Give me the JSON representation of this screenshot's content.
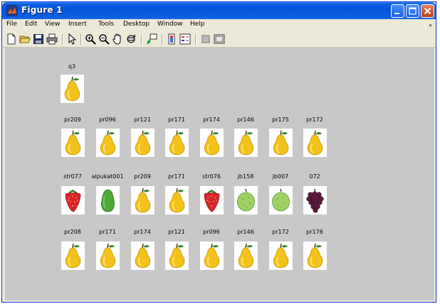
{
  "window": {
    "title": "Figure 1"
  },
  "menu": [
    "File",
    "Edit",
    "View",
    "Insert",
    "Tools",
    "Desktop",
    "Window",
    "Help"
  ],
  "menu_overflow": "»",
  "toolbar": {
    "buttons": [
      "new-figure-icon",
      "open-file-icon",
      "save-icon",
      "print-icon",
      "select-arrow-icon",
      "zoom-in-icon",
      "zoom-out-icon",
      "pan-hand-icon",
      "rotate-3d-icon",
      "data-cursor-icon",
      "insert-colorbar-icon",
      "insert-legend-icon",
      "hide-plot-tools-icon",
      "show-plot-tools-icon"
    ]
  },
  "figure": {
    "query": {
      "label": "q3",
      "fruit": "pear"
    },
    "rows": [
      [
        {
          "label": "pr209",
          "fruit": "pear"
        },
        {
          "label": "pr096",
          "fruit": "pear"
        },
        {
          "label": "pr121",
          "fruit": "pear"
        },
        {
          "label": "pr171",
          "fruit": "pear"
        },
        {
          "label": "pr174",
          "fruit": "pear"
        },
        {
          "label": "pr146",
          "fruit": "pear"
        },
        {
          "label": "pr175",
          "fruit": "pear"
        },
        {
          "label": "pr172",
          "fruit": "pear"
        }
      ],
      [
        {
          "label": "str077",
          "fruit": "strawberry"
        },
        {
          "label": "alpukat001",
          "fruit": "avocado"
        },
        {
          "label": "pr209",
          "fruit": "pear"
        },
        {
          "label": "pr171",
          "fruit": "pear"
        },
        {
          "label": "str076",
          "fruit": "strawberry"
        },
        {
          "label": "jb158",
          "fruit": "guava"
        },
        {
          "label": "jb007",
          "fruit": "guava"
        },
        {
          "label": "072",
          "fruit": "grape"
        }
      ],
      [
        {
          "label": "pr208",
          "fruit": "pear"
        },
        {
          "label": "pr171",
          "fruit": "pear"
        },
        {
          "label": "pr174",
          "fruit": "pear"
        },
        {
          "label": "pr121",
          "fruit": "pear"
        },
        {
          "label": "pr096",
          "fruit": "pear"
        },
        {
          "label": "pr146",
          "fruit": "pear"
        },
        {
          "label": "pr172",
          "fruit": "pear"
        },
        {
          "label": "pr176",
          "fruit": "pear"
        }
      ]
    ]
  },
  "colors": {
    "titlebar": "#0554d6",
    "figure_background": "#c8c8c8",
    "window_chrome": "#ece9d8",
    "pear": "#f2c21a",
    "strawberry": "#d8232a",
    "avocado": "#4fa83a",
    "guava": "#9fd064",
    "grape": "#5a1a3c"
  }
}
